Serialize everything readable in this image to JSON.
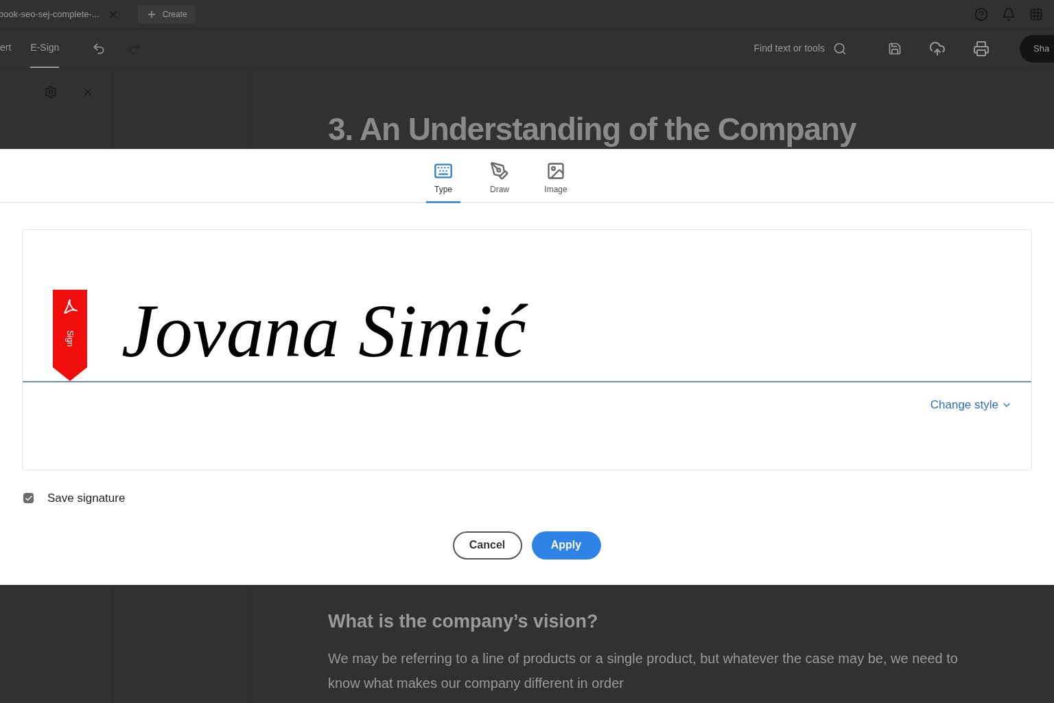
{
  "browser_tab": {
    "title": "book-seo-sej-complete-...",
    "create": "Create"
  },
  "toolbar": {
    "tabs": [
      {
        "label": "ert",
        "selected": false
      },
      {
        "label": "E-Sign",
        "selected": true
      }
    ],
    "search": {
      "placeholder": "Find text or tools"
    },
    "share": "Sha"
  },
  "document": {
    "heading": "3. An Understanding of the Company",
    "subheading": "What is the company’s vision?",
    "paragraph": "We may be referring to a line of products or a single product, but whatever the case may be, we need to know what makes our company different in order"
  },
  "dialog": {
    "modes": [
      {
        "label": "Type",
        "kind": "type",
        "selected": true
      },
      {
        "label": "Draw",
        "kind": "draw",
        "selected": false
      },
      {
        "label": "Image",
        "kind": "image",
        "selected": false
      }
    ],
    "signature": "Jovana Simić",
    "sign_badge": "Sign",
    "change_style": "Change style",
    "save_signature": {
      "label": "Save signature",
      "checked": true
    },
    "buttons": [
      {
        "label": "Cancel",
        "kind": "secondary"
      },
      {
        "label": "Apply",
        "kind": "primary"
      }
    ]
  }
}
